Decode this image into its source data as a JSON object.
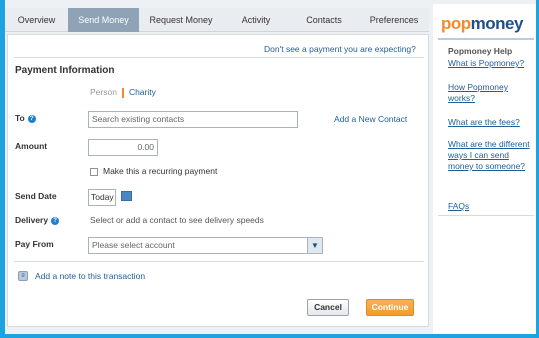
{
  "tabs": [
    {
      "label": "Overview",
      "active": false
    },
    {
      "label": "Send Money",
      "active": true
    },
    {
      "label": "Request Money",
      "active": false
    },
    {
      "label": "Activity",
      "active": false
    },
    {
      "label": "Contacts",
      "active": false
    },
    {
      "label": "Preferences",
      "active": false
    }
  ],
  "main": {
    "expect_link": "Don't see a payment you are expecting?",
    "section_title": "Payment Information",
    "toggle": {
      "person": "Person",
      "charity": "Charity"
    },
    "to": {
      "label": "To",
      "placeholder": "Search existing contacts",
      "add_contact": "Add a New Contact"
    },
    "amount": {
      "label": "Amount",
      "value": "0.00"
    },
    "recurring_label": "Make this a recurring payment",
    "send_date": {
      "label": "Send Date",
      "value": "Today"
    },
    "delivery": {
      "label": "Delivery",
      "text": "Select or add a contact to see delivery speeds"
    },
    "pay_from": {
      "label": "Pay From",
      "placeholder": "Please select account"
    },
    "note_link": "Add a note to this transaction",
    "cancel_label": "Cancel",
    "continue_label": "Continue"
  },
  "sidebar": {
    "logo_pop": "pop",
    "logo_money": "money",
    "help_title": "Popmoney Help",
    "links": [
      "What is Popmoney?",
      "How Popmoney works?",
      "What are the fees?",
      "What are the different ways I can send money to someone?",
      "FAQs"
    ]
  },
  "colors": {
    "accent": "#1fa3e0",
    "active_tab": "#8fa2b6",
    "continue": "#f39a2a",
    "link": "#1f5f99",
    "brand_orange": "#f28c28",
    "brand_blue": "#1f4f86"
  }
}
